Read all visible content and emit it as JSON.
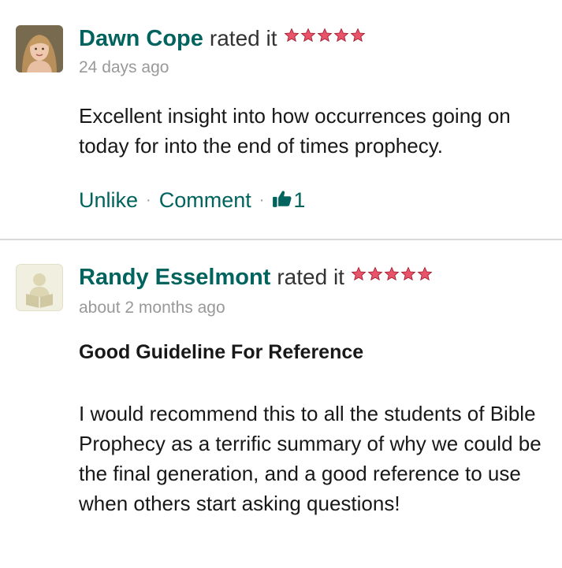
{
  "reviews": [
    {
      "reviewer": "Dawn Cope",
      "rated_text": "rated it",
      "rating": 5,
      "time": "24 days ago",
      "body": "Excellent insight into how occurrences going on today for into the end of times prophecy.",
      "actions": {
        "unlike_label": "Unlike",
        "separator": "·",
        "comment_label": "Comment",
        "like_count": "1",
        "like_icon": "thumbs-up-icon"
      }
    },
    {
      "reviewer": "Randy Esselmont",
      "rated_text": "rated it",
      "rating": 5,
      "time": "about 2 months ago",
      "title": "Good Guideline For Reference",
      "body": "I would recommend this to all the students of Bible Prophecy as a terrific summary of why we could be the final generation, and a good reference to use when others start asking questions!"
    }
  ],
  "colors": {
    "link": "#00635d",
    "star": "#c0253a",
    "muted": "#999999",
    "divider": "#d8d8d8"
  }
}
